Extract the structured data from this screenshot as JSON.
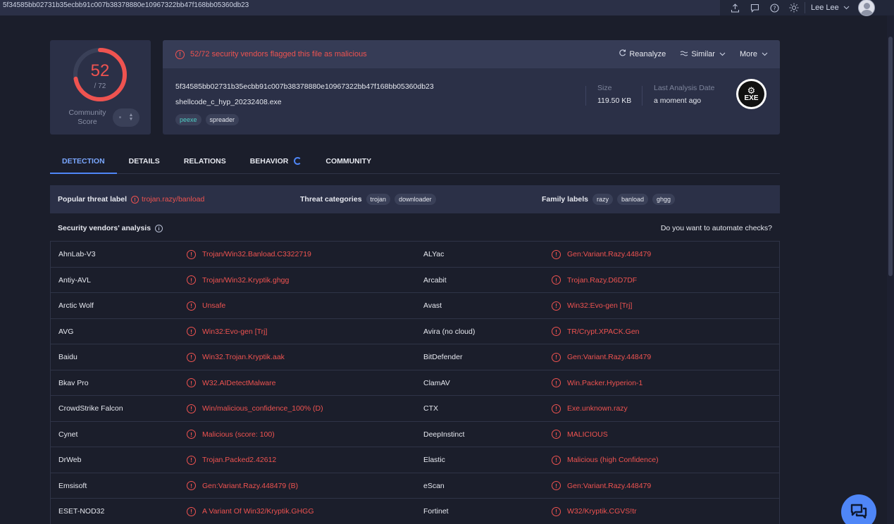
{
  "topbar": {
    "hash": "5f34585bb02731b35ecbb91c007b38378880e10967322bb47f168bb05360db23",
    "user_name": "Lee Lee",
    "icons": [
      "upload-icon",
      "comment-icon",
      "help-icon",
      "theme-sun-icon",
      "chevron-down-icon",
      "avatar"
    ]
  },
  "score": {
    "detected": "52",
    "total": "/ 72",
    "detected_value": 52,
    "total_value": 72,
    "community_label": "Community Score"
  },
  "file": {
    "alert_text": "52/72 security vendors flagged this file as malicious",
    "actions": {
      "reanalyze": "Reanalyze",
      "similar": "Similar",
      "more": "More"
    },
    "sha256": "5f34585bb02731b35ecbb91c007b38378880e10967322bb47f168bb05360db23",
    "name": "shellcode_c_hyp_20232408.exe",
    "tags": [
      "peexe",
      "spreader"
    ],
    "size_label": "Size",
    "size_value": "119.50 KB",
    "date_label": "Last Analysis Date",
    "date_value": "a moment ago",
    "type_badge": "EXE"
  },
  "tabs": [
    {
      "label": "DETECTION",
      "active": true
    },
    {
      "label": "DETAILS",
      "active": false
    },
    {
      "label": "RELATIONS",
      "active": false
    },
    {
      "label": "BEHAVIOR",
      "active": false,
      "loading": true
    },
    {
      "label": "COMMUNITY",
      "active": false
    }
  ],
  "threat": {
    "popular_label_title": "Popular threat label",
    "popular_label_value": "trojan.razy/banload",
    "categories_title": "Threat categories",
    "categories": [
      "trojan",
      "downloader"
    ],
    "family_title": "Family labels",
    "families": [
      "razy",
      "banload",
      "ghgg"
    ]
  },
  "vendors_header": {
    "title": "Security vendors' analysis",
    "automate": "Do you want to automate checks?"
  },
  "vendors": [
    {
      "left_name": "AhnLab-V3",
      "left_result": "Trojan/Win32.Banload.C3322719",
      "right_name": "ALYac",
      "right_result": "Gen:Variant.Razy.448479"
    },
    {
      "left_name": "Antiy-AVL",
      "left_result": "Trojan/Win32.Kryptik.ghgg",
      "right_name": "Arcabit",
      "right_result": "Trojan.Razy.D6D7DF"
    },
    {
      "left_name": "Arctic Wolf",
      "left_result": "Unsafe",
      "right_name": "Avast",
      "right_result": "Win32:Evo-gen [Trj]"
    },
    {
      "left_name": "AVG",
      "left_result": "Win32:Evo-gen [Trj]",
      "right_name": "Avira (no cloud)",
      "right_result": "TR/Crypt.XPACK.Gen"
    },
    {
      "left_name": "Baidu",
      "left_result": "Win32.Trojan.Kryptik.aak",
      "right_name": "BitDefender",
      "right_result": "Gen:Variant.Razy.448479"
    },
    {
      "left_name": "Bkav Pro",
      "left_result": "W32.AIDetectMalware",
      "right_name": "ClamAV",
      "right_result": "Win.Packer.Hyperion-1"
    },
    {
      "left_name": "CrowdStrike Falcon",
      "left_result": "Win/malicious_confidence_100% (D)",
      "right_name": "CTX",
      "right_result": "Exe.unknown.razy"
    },
    {
      "left_name": "Cynet",
      "left_result": "Malicious (score: 100)",
      "right_name": "DeepInstinct",
      "right_result": "MALICIOUS"
    },
    {
      "left_name": "DrWeb",
      "left_result": "Trojan.Packed2.42612",
      "right_name": "Elastic",
      "right_result": "Malicious (high Confidence)"
    },
    {
      "left_name": "Emsisoft",
      "left_result": "Gen:Variant.Razy.448479 (B)",
      "right_name": "eScan",
      "right_result": "Gen:Variant.Razy.448479"
    },
    {
      "left_name": "ESET-NOD32",
      "left_result": "A Variant Of Win32/Kryptik.GHGG",
      "right_name": "Fortinet",
      "right_result": "W32/Kryptik.CGVS!tr"
    }
  ],
  "colors": {
    "background": "#1b1e2b",
    "card": "#2b3047",
    "danger": "#ef5350",
    "accent": "#4f86f7"
  }
}
